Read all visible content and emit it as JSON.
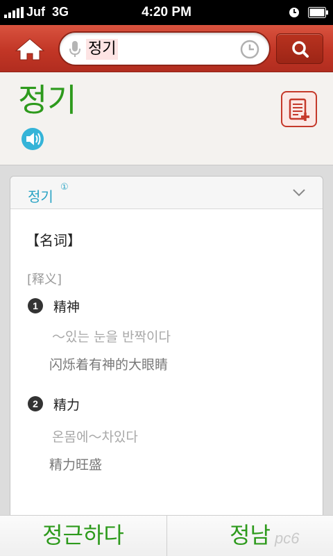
{
  "status_bar": {
    "carrier": "Juf",
    "network": "3G",
    "time": "4:20 PM"
  },
  "search": {
    "value": "정기",
    "icons": [
      "home-icon",
      "mic-icon",
      "history-icon",
      "search-icon"
    ]
  },
  "entry": {
    "headword": "정기",
    "sense_title": "정기",
    "sense_superscript": "①",
    "pos": "【名词】",
    "gloss_label": "[释义]",
    "senses": [
      {
        "num": "1",
        "word": "精神",
        "example_ko": "～있는 눈을 반짝이다",
        "example_zh": "闪烁着有神的大眼睛"
      },
      {
        "num": "2",
        "word": "精力",
        "example_ko": "온몸에～차있다",
        "example_zh": "精力旺盛"
      }
    ]
  },
  "bottom": {
    "prev": "정근하다",
    "next": "정남"
  },
  "watermark": "pc6",
  "colors": {
    "accent_red": "#c23626",
    "headword_green": "#2d9a1c",
    "link_blue": "#2aa3c4"
  }
}
